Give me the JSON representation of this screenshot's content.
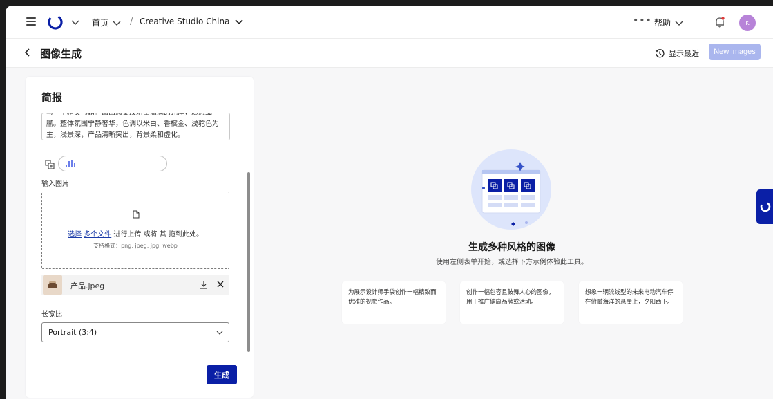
{
  "topbar": {
    "home_label": "首页",
    "separator": "/",
    "workspace_label": "Creative Studio China",
    "more_label": "•••",
    "help_label": "帮助",
    "avatar_initial": "K"
  },
  "page_header": {
    "title": "图像生成",
    "recent_label": "显示最近",
    "new_images_label": "New images"
  },
  "form": {
    "section_title": "简报",
    "brief_text": "与一个精美书籍。画面感受及射出温润的光泽，质感细腻。整体氛围宁静奢华，色调以米白、香槟金、浅驼色为主，浅景深，产品清晰突出，背景柔和虚化。",
    "input_image_label": "输入图片",
    "upload": {
      "select_link": "选择",
      "multi_link": "多个文件",
      "text": "进行上传 或将 其 拖到此处。",
      "formats": "支持格式：png, jpeg, jpg, webp"
    },
    "uploaded_file": "产品.jpeg",
    "aspect_label": "长宽比",
    "aspect_value": "Portrait (3:4)",
    "generate_label": "生成"
  },
  "empty_state": {
    "title": "生成多种风格的图像",
    "subtitle": "使用左侧表单开始，或选择下方示例体验此工具。",
    "examples": [
      "为展示设计师手袋创作一幅精致而优雅的视觉作品。",
      "创作一幅包容且鼓舞人心的图像，用于推广健康品牌或活动。",
      "想象一辆流线型的未来电动汽车停在俯瞰海洋的悬崖上，夕阳西下。"
    ]
  },
  "colors": {
    "primary": "#0a1fa6",
    "new_images_disabled": "#aab6ee",
    "avatar": "#b783d8",
    "link": "#1b3ba8"
  }
}
